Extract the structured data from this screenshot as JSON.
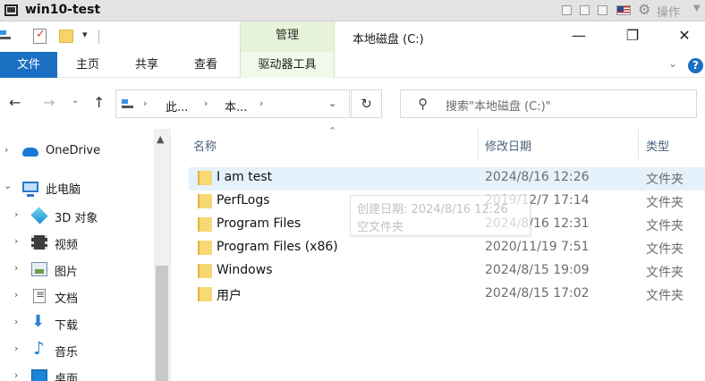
{
  "vm": {
    "title": "win10-test",
    "operate_label": "操作"
  },
  "quick_access": {
    "context_group_label": "管理",
    "window_title": "本地磁盘 (C:)",
    "window_buttons": {
      "minimize": "—",
      "maximize": "❐",
      "close": "✕"
    }
  },
  "ribbon": {
    "tabs": [
      "文件",
      "主页",
      "共享",
      "查看",
      "驱动器工具"
    ],
    "expand_glyph": "⌄",
    "help_glyph": "?"
  },
  "address": {
    "breadcrumbs": [
      "此...",
      "本..."
    ],
    "search_placeholder": "搜索\"本地磁盘 (C:)\""
  },
  "nav_pane": {
    "items": [
      {
        "label": "OneDrive",
        "icon": "onedrive-cloud-icon",
        "expanded": false
      },
      {
        "label": "此电脑",
        "icon": "computer-icon",
        "expanded": true
      },
      {
        "label": "3D 对象",
        "icon": "3d-objects-icon",
        "expanded": false
      },
      {
        "label": "视频",
        "icon": "video-icon",
        "expanded": false
      },
      {
        "label": "图片",
        "icon": "pictures-icon",
        "expanded": false
      },
      {
        "label": "文档",
        "icon": "documents-icon",
        "expanded": false
      },
      {
        "label": "下载",
        "icon": "downloads-icon",
        "expanded": false
      },
      {
        "label": "音乐",
        "icon": "music-icon",
        "expanded": false
      },
      {
        "label": "桌面",
        "icon": "desktop-icon",
        "expanded": false
      }
    ]
  },
  "file_list": {
    "columns": {
      "name": "名称",
      "modified": "修改日期",
      "type": "类型"
    },
    "rows": [
      {
        "name": "I am test",
        "modified": "2024/8/16 12:26",
        "type": "文件夹",
        "selected": true
      },
      {
        "name": "PerfLogs",
        "modified": "2019/12/7 17:14",
        "type": "文件夹",
        "selected": false
      },
      {
        "name": "Program Files",
        "modified": "2024/8/16 12:31",
        "type": "文件夹",
        "selected": false
      },
      {
        "name": "Program Files (x86)",
        "modified": "2020/11/19 7:51",
        "type": "文件夹",
        "selected": false
      },
      {
        "name": "Windows",
        "modified": "2024/8/15 19:09",
        "type": "文件夹",
        "selected": false
      },
      {
        "name": "用户",
        "modified": "2024/8/15 17:02",
        "type": "文件夹",
        "selected": false
      }
    ]
  },
  "tooltip": {
    "line1": "创建日期: 2024/8/16 12:26",
    "line2": "空文件夹"
  },
  "colors": {
    "file_tab_bg": "#1a6fc3",
    "context_tab_bg": "#e7f3d8",
    "selected_row_bg": "#e5f1fb",
    "folder_yellow": "#f8d775"
  }
}
